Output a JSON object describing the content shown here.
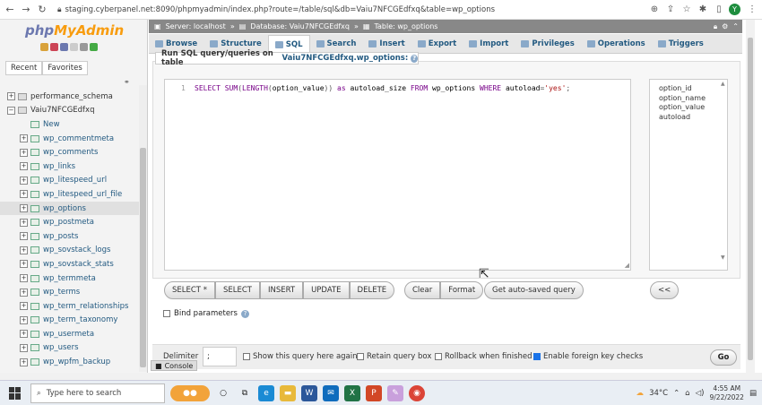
{
  "browser": {
    "url": "staging.cyberpanel.net:8090/phpmyadmin/index.php?route=/table/sql&db=Vaiu7NFCGEdfxq&table=wp_options",
    "avatar": "Y"
  },
  "sidebar": {
    "logo_php": "php",
    "logo_my": "MyAdmin",
    "tabs": [
      "Recent",
      "Favorites"
    ],
    "tree": [
      {
        "label": "performance_schema",
        "level": 0,
        "type": "db"
      },
      {
        "label": "Vaiu7NFCGEdfxq",
        "level": 0,
        "type": "db"
      },
      {
        "label": "New",
        "level": 1,
        "type": "new"
      },
      {
        "label": "wp_commentmeta",
        "level": 1,
        "type": "table"
      },
      {
        "label": "wp_comments",
        "level": 1,
        "type": "table"
      },
      {
        "label": "wp_links",
        "level": 1,
        "type": "table"
      },
      {
        "label": "wp_litespeed_url",
        "level": 1,
        "type": "table"
      },
      {
        "label": "wp_litespeed_url_file",
        "level": 1,
        "type": "table"
      },
      {
        "label": "wp_options",
        "level": 1,
        "type": "table",
        "selected": true
      },
      {
        "label": "wp_postmeta",
        "level": 1,
        "type": "table"
      },
      {
        "label": "wp_posts",
        "level": 1,
        "type": "table"
      },
      {
        "label": "wp_sovstack_logs",
        "level": 1,
        "type": "table"
      },
      {
        "label": "wp_sovstack_stats",
        "level": 1,
        "type": "table"
      },
      {
        "label": "wp_termmeta",
        "level": 1,
        "type": "table"
      },
      {
        "label": "wp_terms",
        "level": 1,
        "type": "table"
      },
      {
        "label": "wp_term_relationships",
        "level": 1,
        "type": "table"
      },
      {
        "label": "wp_term_taxonomy",
        "level": 1,
        "type": "table"
      },
      {
        "label": "wp_usermeta",
        "level": 1,
        "type": "table"
      },
      {
        "label": "wp_users",
        "level": 1,
        "type": "table"
      },
      {
        "label": "wp_wpfm_backup",
        "level": 1,
        "type": "table"
      }
    ]
  },
  "serverbar": {
    "server": "Server: localhost",
    "database": "Database: Vaiu7NFCGEdfxq",
    "table": "Table: wp_options"
  },
  "tabs": [
    {
      "label": "Browse"
    },
    {
      "label": "Structure"
    },
    {
      "label": "SQL",
      "active": true
    },
    {
      "label": "Search"
    },
    {
      "label": "Insert"
    },
    {
      "label": "Export"
    },
    {
      "label": "Import"
    },
    {
      "label": "Privileges"
    },
    {
      "label": "Operations"
    },
    {
      "label": "Triggers"
    }
  ],
  "sql": {
    "legend_prefix": "Run SQL query/queries on table ",
    "legend_table": "Vaiu7NFCGEdfxq.wp_options:",
    "line_number": "1",
    "query": "SELECT SUM(LENGTH(option_value)) as autoload_size FROM wp_options WHERE autoload='yes';",
    "columns": [
      "option_id",
      "option_name",
      "option_value",
      "autoload"
    ],
    "buttons": [
      "SELECT *",
      "SELECT",
      "INSERT",
      "UPDATE",
      "DELETE"
    ],
    "clear": "Clear",
    "format": "Format",
    "auto_saved": "Get auto-saved query",
    "insert_arrow": "<<",
    "bind_params": "Bind parameters"
  },
  "footer": {
    "delimiter_label": "Delimiter",
    "delimiter_value": ";",
    "options": [
      {
        "label": "Show this query here again",
        "checked": false
      },
      {
        "label": "Retain query box",
        "checked": false
      },
      {
        "label": "Rollback when finished",
        "checked": false
      },
      {
        "label": "Enable foreign key checks",
        "checked": true
      }
    ],
    "go": "Go",
    "console": "Console"
  },
  "taskbar": {
    "search_placeholder": "Type here to search",
    "temperature": "34°C",
    "time": "4:55 AM",
    "date": "9/22/2022"
  }
}
